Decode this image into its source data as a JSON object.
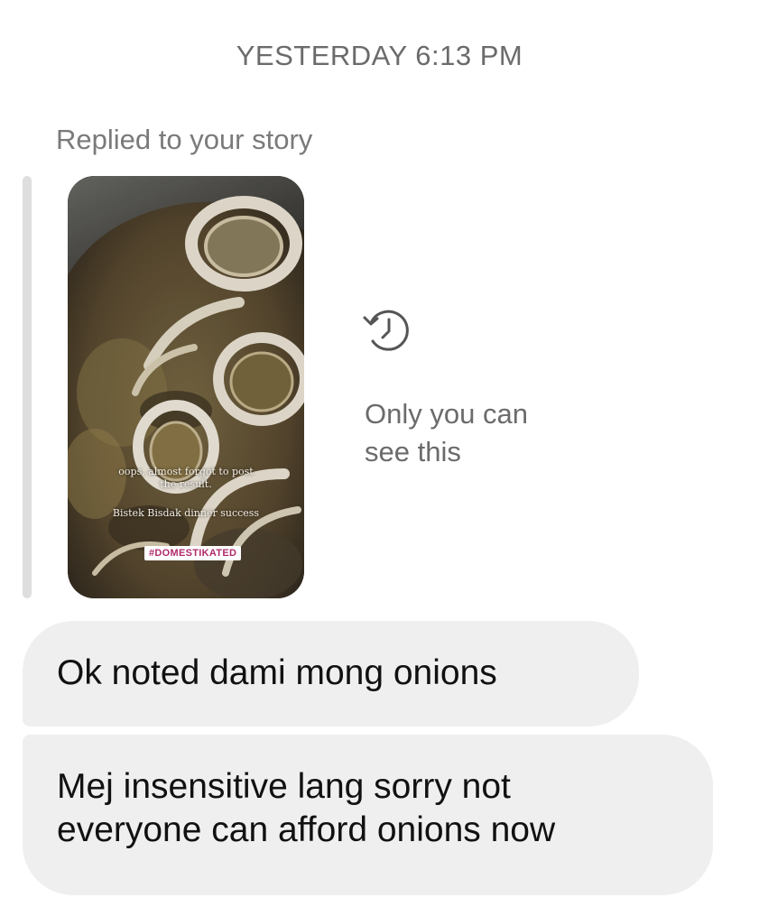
{
  "thread": {
    "timestamp": "YESTERDAY 6:13 PM"
  },
  "story_reply": {
    "label": "Replied to your story",
    "story": {
      "caption_line1": "oops, almost forgot to post",
      "caption_line2": "the result.",
      "caption_line3": "Bistek Bisdak dinner success",
      "hashtag": "#DOMESTIKATED",
      "hashtag_color": "#b02a6b"
    },
    "expired_icon": "history-icon",
    "expired_note_line1": "Only you can",
    "expired_note_line2": "see this"
  },
  "messages": [
    {
      "text": "Ok noted dami mong onions"
    },
    {
      "text_line1": "Mej insensitive lang sorry not",
      "text_line2": "everyone can afford onions now"
    }
  ],
  "colors": {
    "bubble_bg": "#efefef",
    "meta_text": "#6b6b6b"
  }
}
